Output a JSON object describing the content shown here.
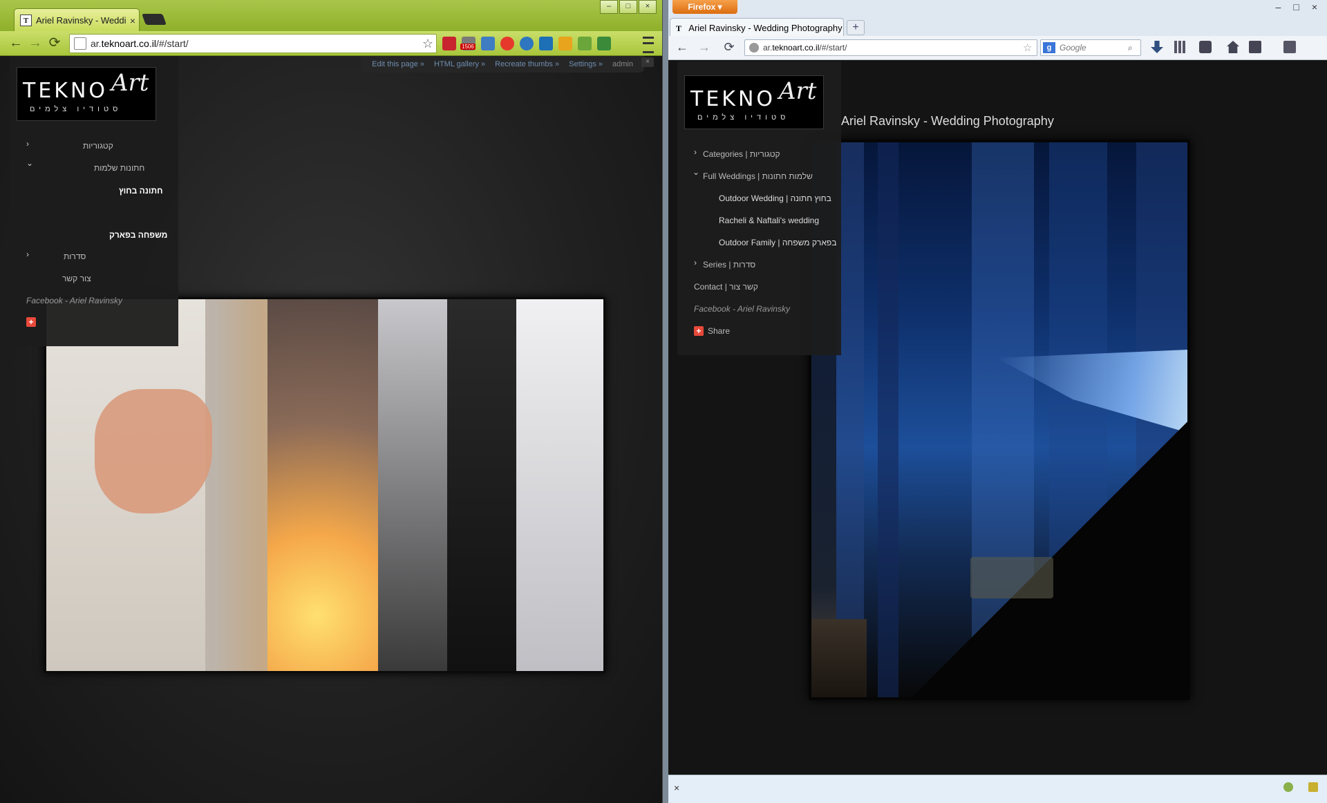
{
  "chrome": {
    "tab_title": "Ariel Ravinsky - Wedding",
    "tab_favicon": "T",
    "url_prefix": "ar.",
    "url_domain": "teknoart.co.il",
    "url_path": "/#/start/",
    "ext_badge": "1506",
    "adminbar": {
      "edit": "Edit this page »",
      "html_gallery": "HTML gallery »",
      "recreate": "Recreate thumbs »",
      "settings": "Settings »",
      "admin": "admin"
    },
    "admin_close": "×",
    "logo": {
      "word": "TEKNO",
      "script": "Art",
      "sub": "סטודיו צלמים"
    },
    "menu": {
      "categories": "קטגוריות",
      "full_weddings": "חתונות שלמות",
      "outdoor_wedding": "חתונה בחוץ",
      "outdoor_family": "משפחה בפארק",
      "series": "סדרות",
      "contact": "צור קשר",
      "facebook": "Facebook - Ariel Ravinsky"
    }
  },
  "firefox": {
    "button": "Firefox",
    "tab_title": "Ariel Ravinsky - Wedding Photography ...",
    "tab_favicon": "T",
    "url_prefix": "ar.",
    "url_domain": "teknoart.co.il",
    "url_path": "/#/start/",
    "search_placeholder": "Google",
    "page_heading": "Ariel Ravinsky - Wedding Photography",
    "logo": {
      "word": "TEKNO",
      "script": "Art",
      "sub": "סטודיו צלמים"
    },
    "menu": {
      "categories": "Categories | קטגוריות",
      "full_weddings": "Full Weddings | שלמות חתונות",
      "outdoor_wedding": "Outdoor Wedding | בחוץ חתונה",
      "racheli": "Racheli & Naftali's wedding",
      "outdoor_family": "Outdoor Family | בפארק משפחה",
      "series": "Series | סדרות",
      "contact": "Contact | קשר צור",
      "facebook": "Facebook - Ariel Ravinsky",
      "share": "Share"
    },
    "status_close": "×"
  },
  "icons": {
    "back": "←",
    "forward": "→",
    "reload": "⟳",
    "star": "☆",
    "chev_right": "›",
    "chev_down": "⌄",
    "plus": "+",
    "close": "×",
    "minimize": "–",
    "maximize": "□"
  },
  "colors": {
    "chrome_theme": "#a9c63b",
    "firefox_orange": "#e67a1c",
    "link_blue": "#6f8db0",
    "share_red": "#e8493b"
  }
}
